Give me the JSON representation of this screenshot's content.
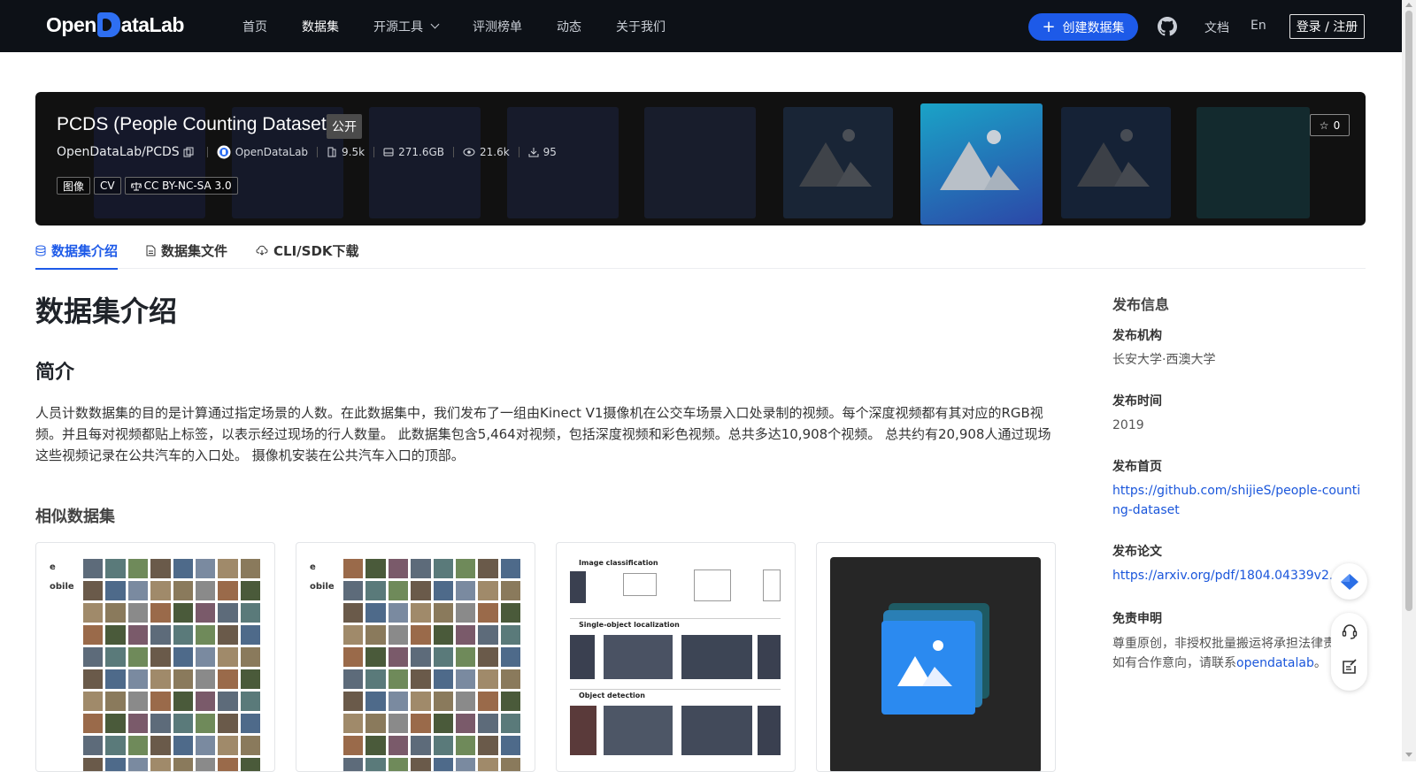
{
  "nav": {
    "logo_prefix": "Open",
    "logo_suffix": "ataLab",
    "items": [
      "首页",
      "数据集",
      "开源工具",
      "评测榜单",
      "动态",
      "关于我们"
    ],
    "active_index": 1,
    "create_label": "创建数据集",
    "doc_label": "文档",
    "lang_label": "En",
    "login_label": "登录 / 注册"
  },
  "hero": {
    "title": "PCDS (People Counting Dataset)",
    "visibility": "公开",
    "repo": "OpenDataLab/PCDS",
    "publisher": "OpenDataLab",
    "files": "9.5k",
    "size": "271.6GB",
    "views": "21.6k",
    "downloads": "95",
    "tags": [
      "图像",
      "CV",
      "CC BY-NC-SA 3.0"
    ],
    "stars": "0"
  },
  "tabs": [
    "数据集介绍",
    "数据集文件",
    "CLI/SDK下载"
  ],
  "content": {
    "heading": "数据集介绍",
    "intro_heading": "简介",
    "intro_text": "人员计数数据集的目的是计算通过指定场景的人数。在此数据集中，我们发布了一组由Kinect V1摄像机在公交车场景入口处录制的视频。每个深度视频都有其对应的RGB视频。并且每对视频都贴上标签，以表示经过现场的行人数量。 此数据集包含5,464对视频，包括深度视频和彩色视频。总共多达10,908个视频。 总共约有20,908人通过现场 这些视频记录在公共汽车的入口处。 摄像机安装在公共汽车入口的顶部。",
    "similar_heading": "相似数据集",
    "card1_edge": [
      "e",
      "obile"
    ],
    "card2_edge": [
      "e",
      "obile"
    ],
    "card3_labels": [
      "Image classification",
      "Single-object localization",
      "Object detection"
    ]
  },
  "sidebar": {
    "title": "发布信息",
    "org_label": "发布机构",
    "org_value": "长安大学·西澳大学",
    "time_label": "发布时间",
    "time_value": "2019",
    "home_label": "发布首页",
    "home_value": "https://github.com/shijieS/people-counting-dataset",
    "paper_label": "发布论文",
    "paper_value": "https://arxiv.org/pdf/1804.04339v2.pdf",
    "disclaimer_label": "免责申明",
    "disclaimer_line1": "尊重原创，非授权批量搬运将承担法律责",
    "disclaimer_line2_prefix": "如有合作意向，请联系",
    "disclaimer_link": "opendatalab",
    "disclaimer_line2_suffix": "。"
  },
  "colors": {
    "nav_bg": "#0d1117",
    "accent": "#1d5ae8",
    "link": "#1a56db"
  }
}
